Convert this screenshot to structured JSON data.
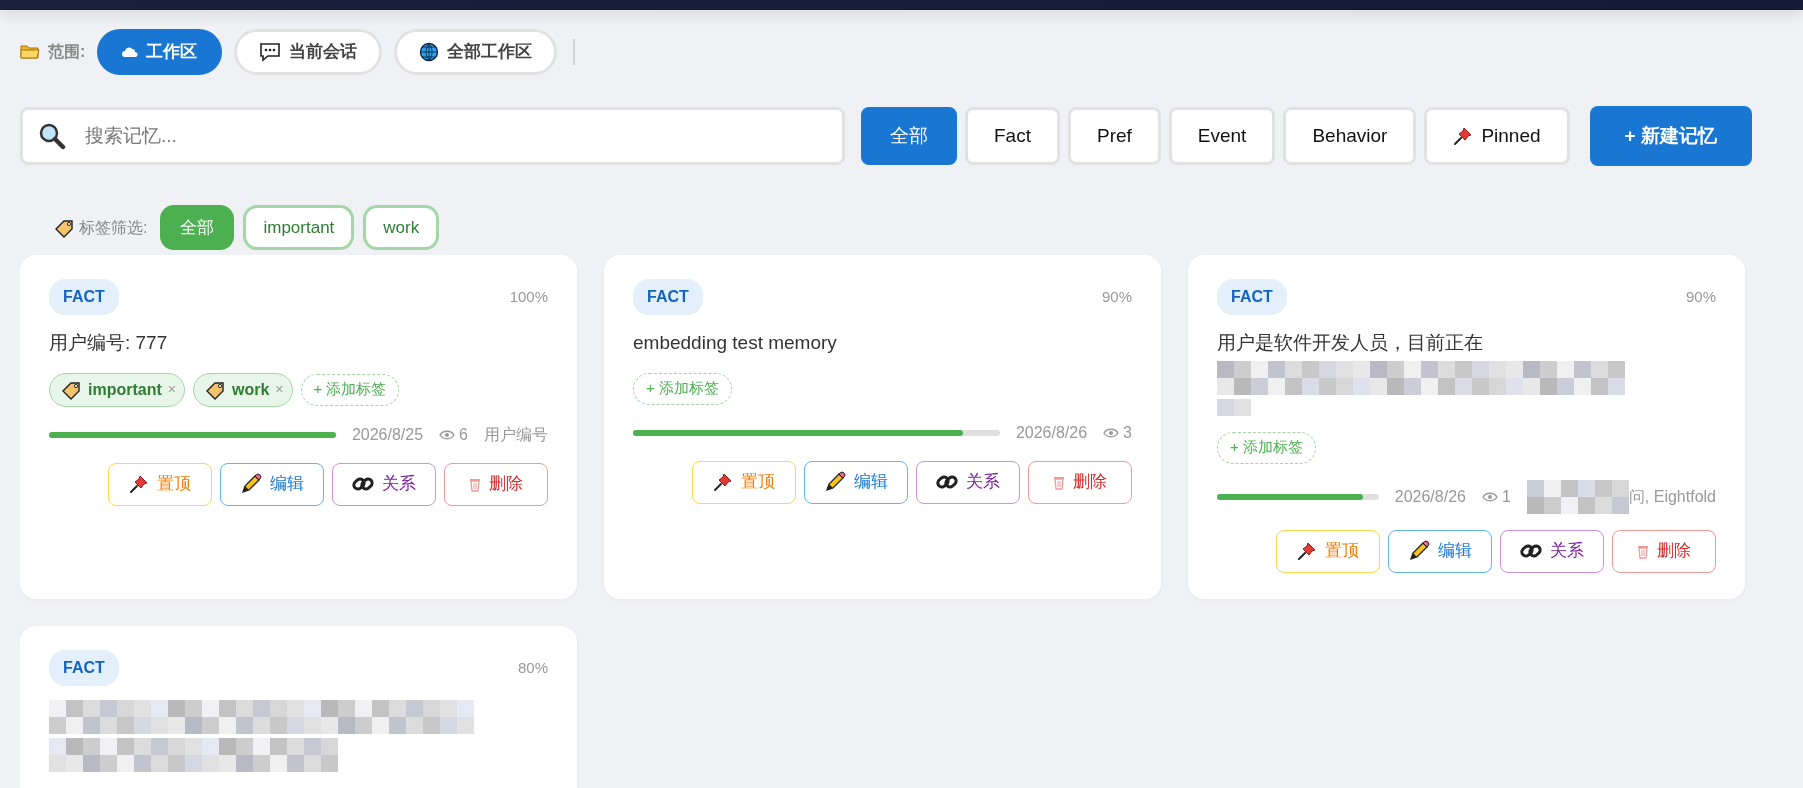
{
  "scope": {
    "label": "范围:",
    "options": [
      {
        "label": "工作区",
        "selected": true
      },
      {
        "label": "当前会话",
        "selected": false
      },
      {
        "label": "全部工作区",
        "selected": false
      }
    ]
  },
  "search": {
    "placeholder": "搜索记忆..."
  },
  "type_filters": [
    {
      "label": "全部",
      "selected": true
    },
    {
      "label": "Fact",
      "selected": false
    },
    {
      "label": "Pref",
      "selected": false
    },
    {
      "label": "Event",
      "selected": false
    },
    {
      "label": "Behavior",
      "selected": false
    },
    {
      "label": "Pinned",
      "selected": false
    }
  ],
  "new_button": "+ 新建记忆",
  "tag_filter": {
    "label": "标签筛选:",
    "options": [
      {
        "label": "全部",
        "selected": true
      },
      {
        "label": "important",
        "selected": false
      },
      {
        "label": "work",
        "selected": false
      }
    ]
  },
  "cards": [
    {
      "type": "FACT",
      "score": "100%",
      "content": "用户编号: 777",
      "tags": [
        {
          "label": "important",
          "remove": "×"
        },
        {
          "label": "work",
          "remove": "×"
        }
      ],
      "add_tag": "+ 添加标签",
      "level": 1,
      "date": "2026/8/25",
      "views": "6",
      "source": "用户编号",
      "actions": [
        {
          "kind": "pin",
          "label": "置顶"
        },
        {
          "kind": "edit",
          "label": "编辑"
        },
        {
          "kind": "relation",
          "label": "关系"
        },
        {
          "kind": "delete",
          "label": "删除"
        }
      ]
    },
    {
      "type": "FACT",
      "score": "90%",
      "content": "embedding test memory",
      "add_tag": "+ 添加标签",
      "level": 0.9,
      "date": "2026/8/26",
      "views": "3",
      "actions": [
        {
          "kind": "pin",
          "label": "置顶"
        },
        {
          "kind": "edit",
          "label": "编辑"
        },
        {
          "kind": "relation",
          "label": "关系"
        },
        {
          "kind": "delete",
          "label": "删除"
        }
      ]
    },
    {
      "type": "FACT",
      "score": "90%",
      "content": "用户是软件开发人员，目前正在",
      "redacted": true,
      "add_tag": "+ 添加标签",
      "level": 0.9,
      "date": "2026/8/26",
      "views": "1",
      "source": "问, Eightfold",
      "source_redacted": true,
      "actions": [
        {
          "kind": "pin",
          "label": "置顶"
        },
        {
          "kind": "edit",
          "label": "编辑"
        },
        {
          "kind": "relation",
          "label": "关系"
        },
        {
          "kind": "delete",
          "label": "删除"
        }
      ]
    },
    {
      "type": "FACT",
      "score": "80%",
      "redacted": true
    }
  ]
}
